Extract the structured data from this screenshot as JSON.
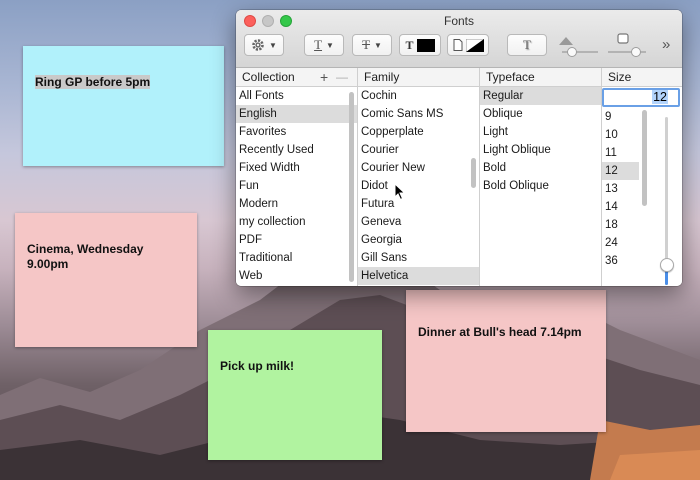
{
  "notes": {
    "note1": "Ring GP before 5pm",
    "note2": "Cinema, Wednesday\n9.00pm",
    "note3": "Pick up milk!",
    "note4": "Dinner at Bull's head 7.14pm"
  },
  "fonts_window": {
    "title": "Fonts",
    "toolbar": {
      "gear_icon": "gear-icon",
      "underline_label": "T",
      "strikethrough_label": "T",
      "text_color_label": "T",
      "document_color_icon": "document-icon",
      "text_shadow_label": "T",
      "overflow_label": "»",
      "text_color": "#000000"
    },
    "headers": {
      "collection": "Collection",
      "add": "+",
      "remove": "—",
      "family": "Family",
      "typeface": "Typeface",
      "size": "Size"
    },
    "collections": [
      "All Fonts",
      "English",
      "Favorites",
      "Recently Used",
      "Fixed Width",
      "Fun",
      "Modern",
      "my collection",
      "PDF",
      "Traditional",
      "Web"
    ],
    "families": [
      "Cochin",
      "Comic Sans MS",
      "Copperplate",
      "Courier",
      "Courier New",
      "Didot",
      "Futura",
      "Geneva",
      "Georgia",
      "Gill Sans",
      "Helvetica"
    ],
    "typefaces": [
      "Regular",
      "Oblique",
      "Light",
      "Light Oblique",
      "Bold",
      "Bold Oblique"
    ],
    "size_value": "12",
    "sizes": [
      "9",
      "10",
      "11",
      "12",
      "13",
      "14",
      "18",
      "24",
      "36"
    ],
    "selected": {
      "collection": "English",
      "family": "Helvetica",
      "typeface": "Regular",
      "size": "12"
    },
    "size_slider_level": 0.12
  }
}
